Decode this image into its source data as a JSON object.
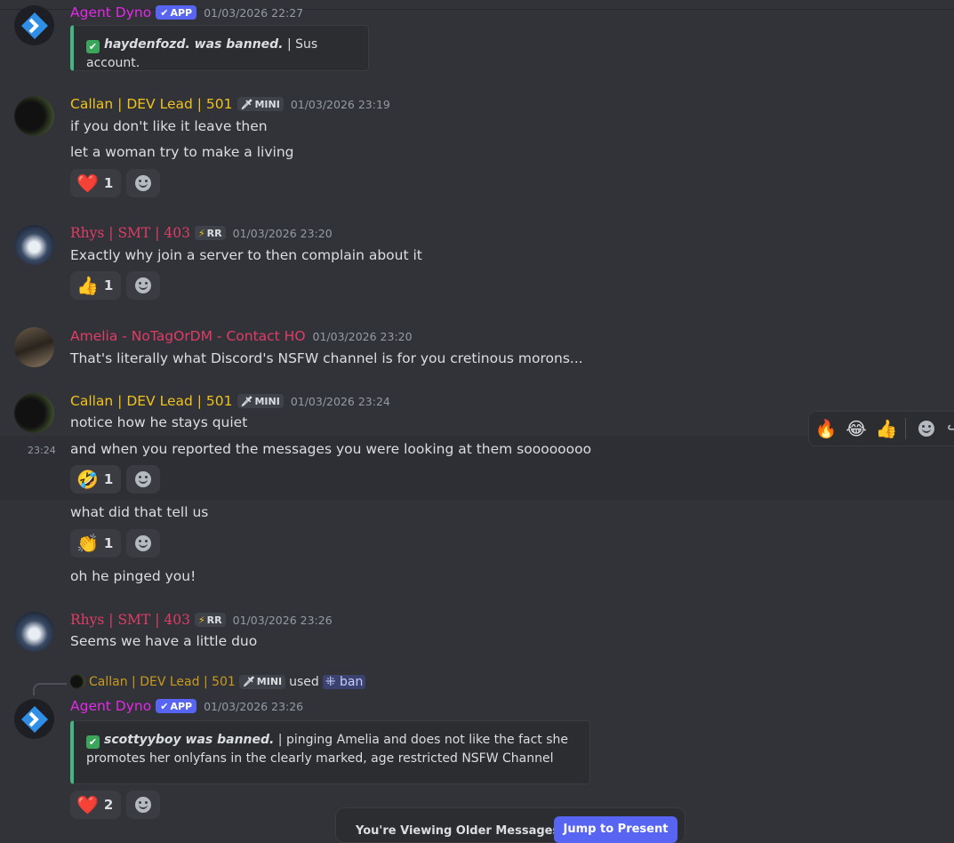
{
  "colors": {
    "dyno": "#e12ae6",
    "callan": "#f0c21c",
    "rhys": "#e03c65",
    "amelia": "#e03c65",
    "reply_user": "#c99a1e",
    "embed_accent": "#43b581"
  },
  "icons": {
    "verified": "check-icon",
    "mini_tag": "sword-icon",
    "rr_tag": "lightning-icon",
    "add_reaction": "smile-icon",
    "forward": "forward-icon",
    "command": "grid-icon"
  },
  "messages": {
    "m1": {
      "username": "Agent Dyno",
      "tag": "APP",
      "timestamp": "01/03/2026 22:27",
      "embed": {
        "bold": "haydenfozd. was banned.",
        "rest": " | Sus account."
      }
    },
    "m2": {
      "username": "Callan | DEV Lead | 501",
      "tag": "MINI",
      "timestamp": "01/03/2026 23:19",
      "lines": [
        "if you don't like it leave then",
        "let a woman try to make a living"
      ],
      "reaction": {
        "emoji": "❤️",
        "count": "1"
      }
    },
    "m3": {
      "username": "Rhys | SMT | 403",
      "tag": "RR",
      "timestamp": "01/03/2026 23:20",
      "lines": [
        "Exactly why join a server to then complain about it"
      ],
      "reaction": {
        "emoji": "👍",
        "count": "1"
      }
    },
    "m4": {
      "username": "Amelia - NoTagOrDM - Contact HO",
      "timestamp": "01/03/2026 23:20",
      "lines": [
        "That's literally what Discord's NSFW channel is for you cretinous morons..."
      ]
    },
    "m5": {
      "username": "Callan | DEV Lead | 501",
      "tag": "MINI",
      "timestamp": "01/03/2026 23:24",
      "lines": [
        "notice how he stays quiet",
        "and when you reported the messages you were looking at them soooooooo",
        "what did that tell us",
        "oh he pinged you!"
      ],
      "hover_time": "23:24",
      "reaction_a": {
        "emoji": "🤣",
        "count": "1"
      },
      "reaction_b": {
        "emoji": "👏",
        "count": "1"
      }
    },
    "m6": {
      "username": "Rhys | SMT | 403",
      "tag": "RR",
      "timestamp": "01/03/2026 23:26",
      "lines": [
        "Seems we have a little duo"
      ]
    },
    "m7": {
      "reply_user": "Callan | DEV Lead | 501",
      "reply_tag": "MINI",
      "reply_used": "used",
      "reply_command": "ban",
      "username": "Agent Dyno",
      "tag": "APP",
      "timestamp": "01/03/2026 23:26",
      "embed": {
        "bold": "scottyyboy was banned.",
        "rest": " | pinging Amelia and does not like the fact she promotes her onlyfans in the clearly marked, age restricted NSFW Channel"
      },
      "reaction": {
        "emoji": "❤️",
        "count": "2"
      }
    }
  },
  "toolbar": {
    "quick_reactions": [
      "🔥",
      "😂",
      "👍"
    ]
  },
  "bottom_bar": {
    "text": "You're Viewing Older Messages",
    "button": "Jump to Present"
  }
}
